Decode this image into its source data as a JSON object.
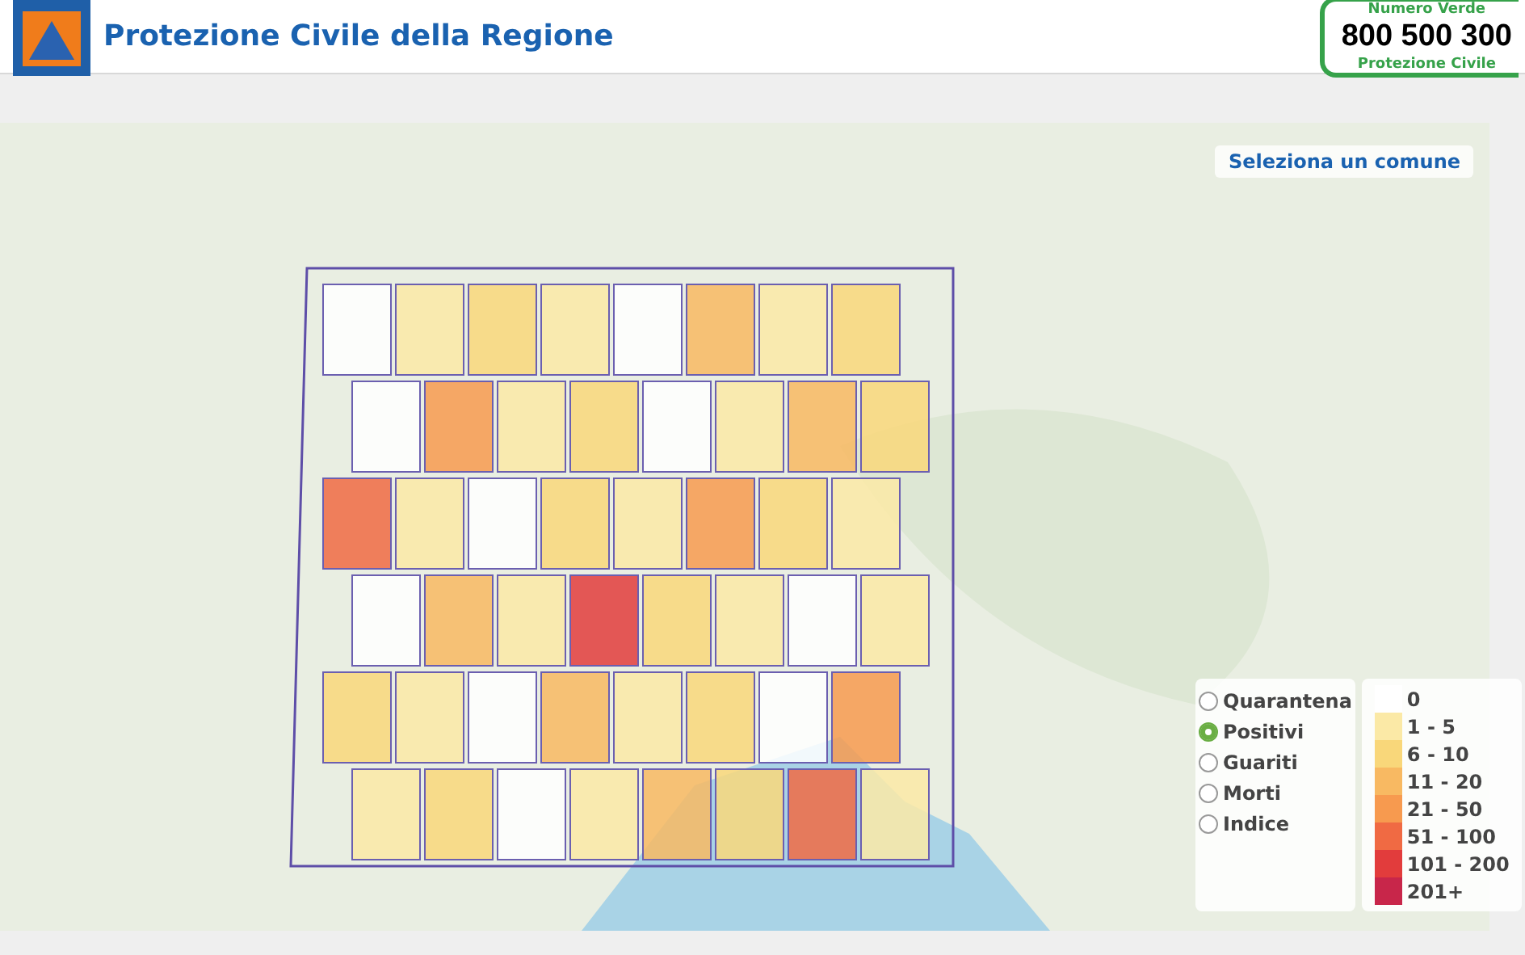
{
  "header": {
    "title": "Protezione Civile della Regione",
    "hotline": {
      "caption_top": "Numero Verde",
      "number": "800 500 300",
      "caption_bottom": "Protezione Civile"
    }
  },
  "map": {
    "select_label": "Seleziona un comune",
    "layers": [
      {
        "label": "Quarantena",
        "selected": false
      },
      {
        "label": "Positivi",
        "selected": true
      },
      {
        "label": "Guariti",
        "selected": false
      },
      {
        "label": "Morti",
        "selected": false
      },
      {
        "label": "Indice",
        "selected": false
      }
    ],
    "legend": [
      {
        "label": "0",
        "color": "#ffffff"
      },
      {
        "label": "1 - 5",
        "color": "#fbe9a6"
      },
      {
        "label": "6 - 10",
        "color": "#f9d77a"
      },
      {
        "label": "11 - 20",
        "color": "#f8b962"
      },
      {
        "label": "21 - 50",
        "color": "#f79a4f"
      },
      {
        "label": "51 - 100",
        "color": "#f06a43"
      },
      {
        "label": "101 - 200",
        "color": "#e23c3c"
      },
      {
        "label": "201+",
        "color": "#c8264a"
      }
    ]
  }
}
